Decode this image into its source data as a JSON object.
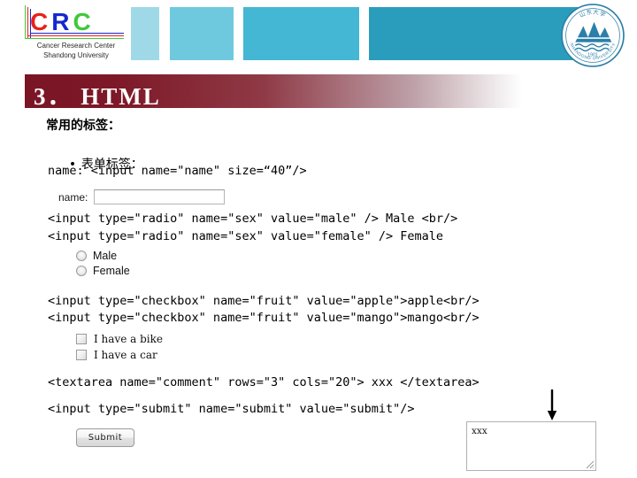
{
  "header": {
    "logo": {
      "letters": [
        "C",
        "R",
        "C"
      ],
      "letter_colors": [
        "#e8211a",
        "#1528cf",
        "#3fc93b"
      ],
      "subtitle_line1": "Cancer Research Center",
      "subtitle_line2": "Shandong University"
    },
    "color_blocks": [
      {
        "name": "block-1",
        "color": "#9fd9e8"
      },
      {
        "name": "block-2",
        "color": "#6ec9de"
      },
      {
        "name": "block-3",
        "color": "#43b7d3"
      },
      {
        "name": "block-4",
        "color": "#2b9dbc"
      }
    ],
    "seal": {
      "top_text": "山东大学",
      "year": "1901",
      "ring_text": "SHANDONG UNIVERSITY",
      "color": "#2b7fa8"
    }
  },
  "slide": {
    "title": "3． HTML",
    "title_bar_start_color": "#7a1526",
    "title_bar_end_color": "#ffffff",
    "heading": "常用的标签：",
    "bullet_symbol": "•",
    "bullet_text": "表单标签："
  },
  "code": {
    "name_input": "name: <input name=\"name\" size=“40”/>",
    "radio_male": "<input type=\"radio\" name=\"sex\" value=\"male\" /> Male <br/>",
    "radio_female": "<input type=\"radio\" name=\"sex\" value=\"female\" /> Female",
    "checkbox_apple": "<input type=\"checkbox\" name=\"fruit\" value=\"apple\">apple<br/>",
    "checkbox_mango": "<input type=\"checkbox\" name=\"fruit\" value=\"mango\">mango<br/>",
    "textarea": "<textarea name=\"comment\" rows=\"3\" cols=\"20\"> xxx </textarea>",
    "submit": "<input type=\"submit\" name=\"submit\" value=\"submit\"/>"
  },
  "widgets": {
    "name_label": "name:",
    "name_value": "",
    "name_placeholder": "",
    "radios": [
      {
        "label": "Male",
        "checked": false
      },
      {
        "label": "Female",
        "checked": false
      }
    ],
    "checkboxes": [
      {
        "label": "I have a bike",
        "checked": false
      },
      {
        "label": "I have a car",
        "checked": false
      }
    ],
    "submit_label": "Submit",
    "textarea_value": "xxx"
  }
}
